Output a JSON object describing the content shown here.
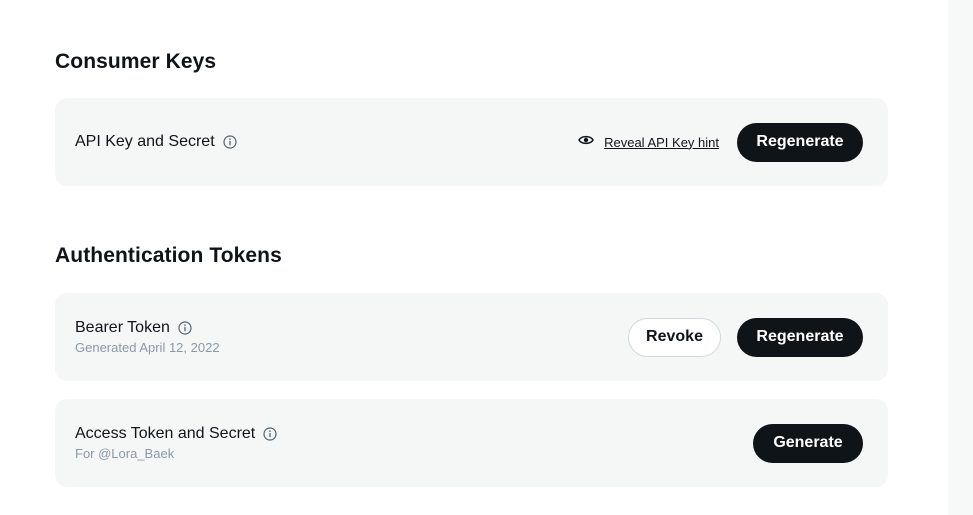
{
  "consumer_keys": {
    "heading": "Consumer Keys",
    "api_key": {
      "label": "API Key and Secret",
      "reveal_link": "Reveal API Key hint",
      "regenerate_button": "Regenerate"
    }
  },
  "auth_tokens": {
    "heading": "Authentication Tokens",
    "bearer": {
      "label": "Bearer Token",
      "subtext": "Generated April 12, 2022",
      "revoke_button": "Revoke",
      "regenerate_button": "Regenerate"
    },
    "access": {
      "label": "Access Token and Secret",
      "subtext": "For @Lora_Baek",
      "generate_button": "Generate"
    }
  },
  "icons": {
    "info": "info-icon",
    "reveal": "eye-icon"
  },
  "colors": {
    "primary_dark": "#0f1419",
    "card_bg": "#f5f7f7",
    "muted_text": "#8b98a5"
  }
}
